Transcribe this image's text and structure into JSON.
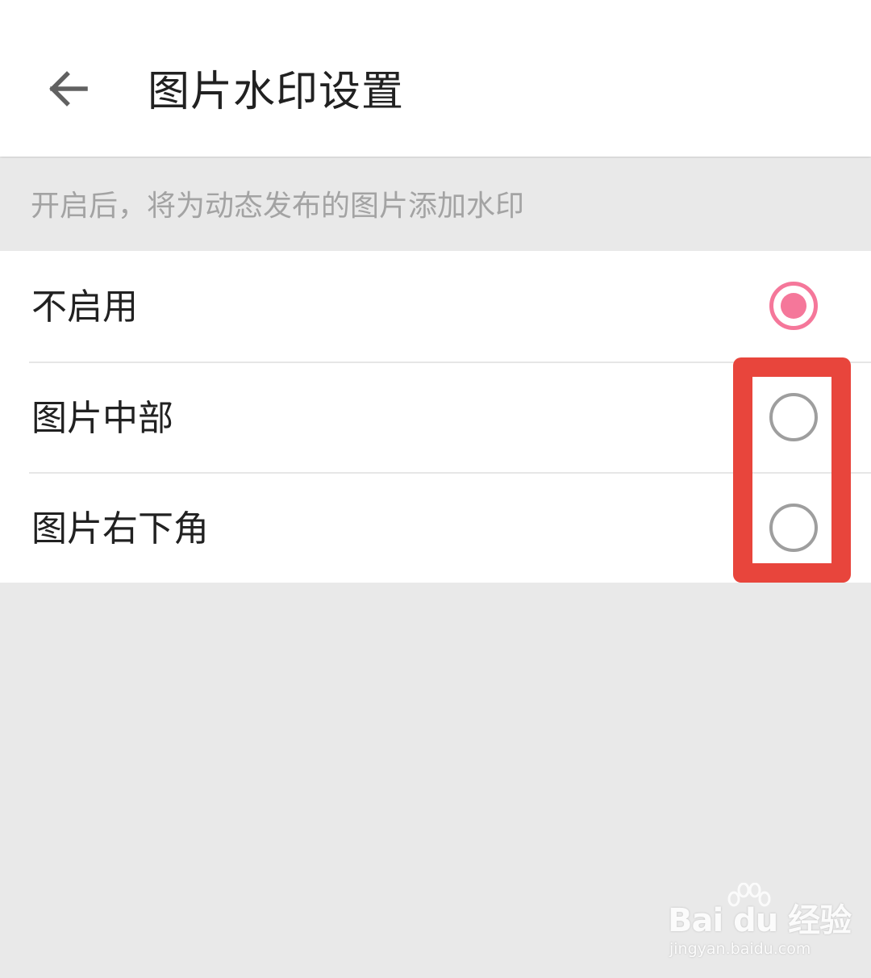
{
  "header": {
    "title": "图片水印设置",
    "back_icon": "arrow-left-icon"
  },
  "hint": {
    "text": "开启后，将为动态发布的图片添加水印"
  },
  "options": [
    {
      "label": "不启用",
      "selected": true
    },
    {
      "label": "图片中部",
      "selected": false
    },
    {
      "label": "图片右下角",
      "selected": false
    }
  ],
  "colors": {
    "accent": "#f5779a",
    "highlight": "#e8453c",
    "radio_off": "#9e9e9e",
    "background": "#e9e9e9"
  },
  "watermark": {
    "logo": "Bai du 经验",
    "url": "jingyan.baidu.com"
  }
}
